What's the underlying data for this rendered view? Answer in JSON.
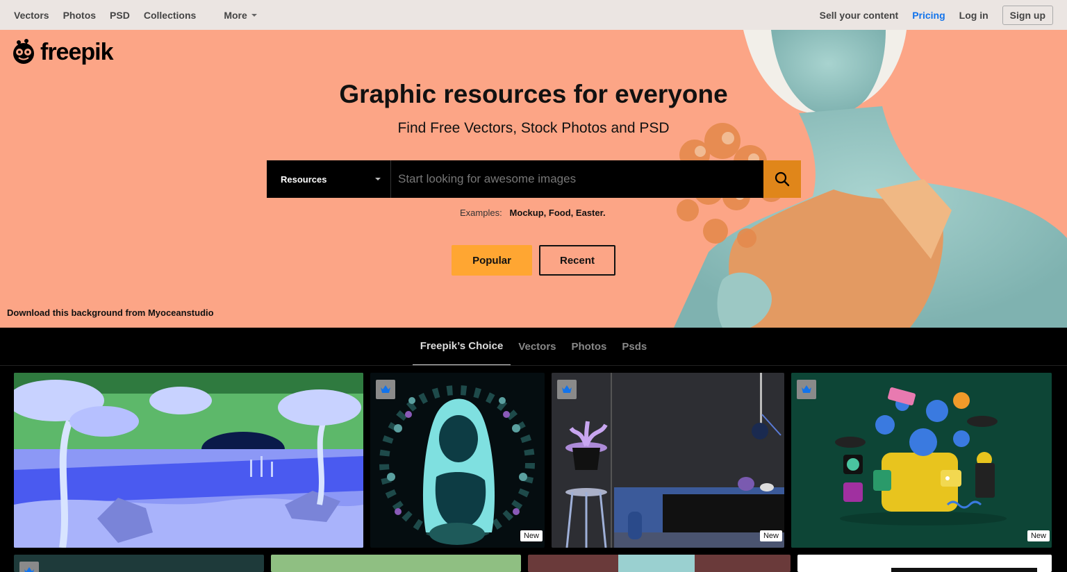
{
  "topnav": {
    "left": [
      "Vectors",
      "Photos",
      "PSD",
      "Collections"
    ],
    "more_label": "More",
    "sell": "Sell your content",
    "pricing": "Pricing",
    "login": "Log in",
    "signup": "Sign up"
  },
  "brand": {
    "name": "freepik"
  },
  "hero": {
    "title": "Graphic resources for everyone",
    "subtitle": "Find Free Vectors, Stock Photos and PSD",
    "search": {
      "category": "Resources",
      "placeholder": "Start looking for awesome images"
    },
    "examples_label": "Examples:",
    "examples": [
      "Mockup,",
      "Food,",
      "Easter."
    ],
    "popular_label": "Popular",
    "recent_label": "Recent",
    "credit": "Download this background from Myoceanstudio"
  },
  "tabs": [
    {
      "label": "Freepik’s Choice",
      "active": true
    },
    {
      "label": "Vectors",
      "active": false
    },
    {
      "label": "Photos",
      "active": false
    },
    {
      "label": "Psds",
      "active": false
    }
  ],
  "cards": {
    "new_label": "New",
    "items": [
      {
        "name": "savanna-illustration",
        "premium": false,
        "new": false
      },
      {
        "name": "mother-child-illustration",
        "premium": true,
        "new": true
      },
      {
        "name": "interior-3d-render",
        "premium": true,
        "new": true
      },
      {
        "name": "crypto-wallet-illustration",
        "premium": true,
        "new": true
      }
    ]
  },
  "colors": {
    "hero_bg": "#fca586",
    "accent_orange": "#e0861a",
    "popular_btn": "#ffa632",
    "pricing_link": "#1273eb",
    "page_bg": "#000000"
  }
}
